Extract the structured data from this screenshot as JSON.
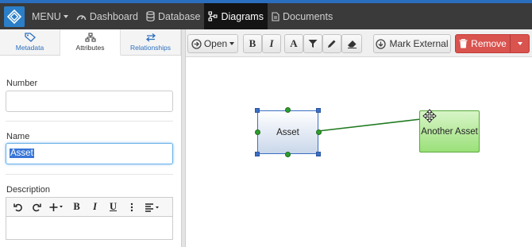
{
  "navbar": {
    "menu_label": "MENU",
    "items": [
      {
        "label": "Dashboard",
        "icon": "dashboard-icon"
      },
      {
        "label": "Database",
        "icon": "database-icon"
      },
      {
        "label": "Diagrams",
        "icon": "diagram-icon",
        "active": true
      },
      {
        "label": "Documents",
        "icon": "document-icon"
      }
    ]
  },
  "tabs": [
    {
      "label": "Metadata",
      "icon": "tag-icon"
    },
    {
      "label": "Attributes",
      "icon": "sitemap-icon",
      "active": true
    },
    {
      "label": "Relationships",
      "icon": "exchange-icon"
    }
  ],
  "form": {
    "number_label": "Number",
    "number_value": "",
    "name_label": "Name",
    "name_value": "Asset",
    "description_label": "Description"
  },
  "editor_toolbar": {
    "bold": "B",
    "italic": "I",
    "underline": "U"
  },
  "toolbar": {
    "open_label": "Open",
    "bold": "B",
    "italic": "I",
    "font": "A",
    "mark_external_label": "Mark External",
    "remove_label": "Remove"
  },
  "diagram": {
    "nodes": [
      {
        "label": "Asset",
        "selected": true
      },
      {
        "label": "Another Asset",
        "selected": false
      }
    ]
  },
  "colors": {
    "accent": "#2a6fbf",
    "navbar": "#3a3a3a",
    "danger": "#d9534f",
    "node_selected_border": "#3a6fc4",
    "node_green": "#9be07a",
    "connector": "#1f7a1f"
  }
}
